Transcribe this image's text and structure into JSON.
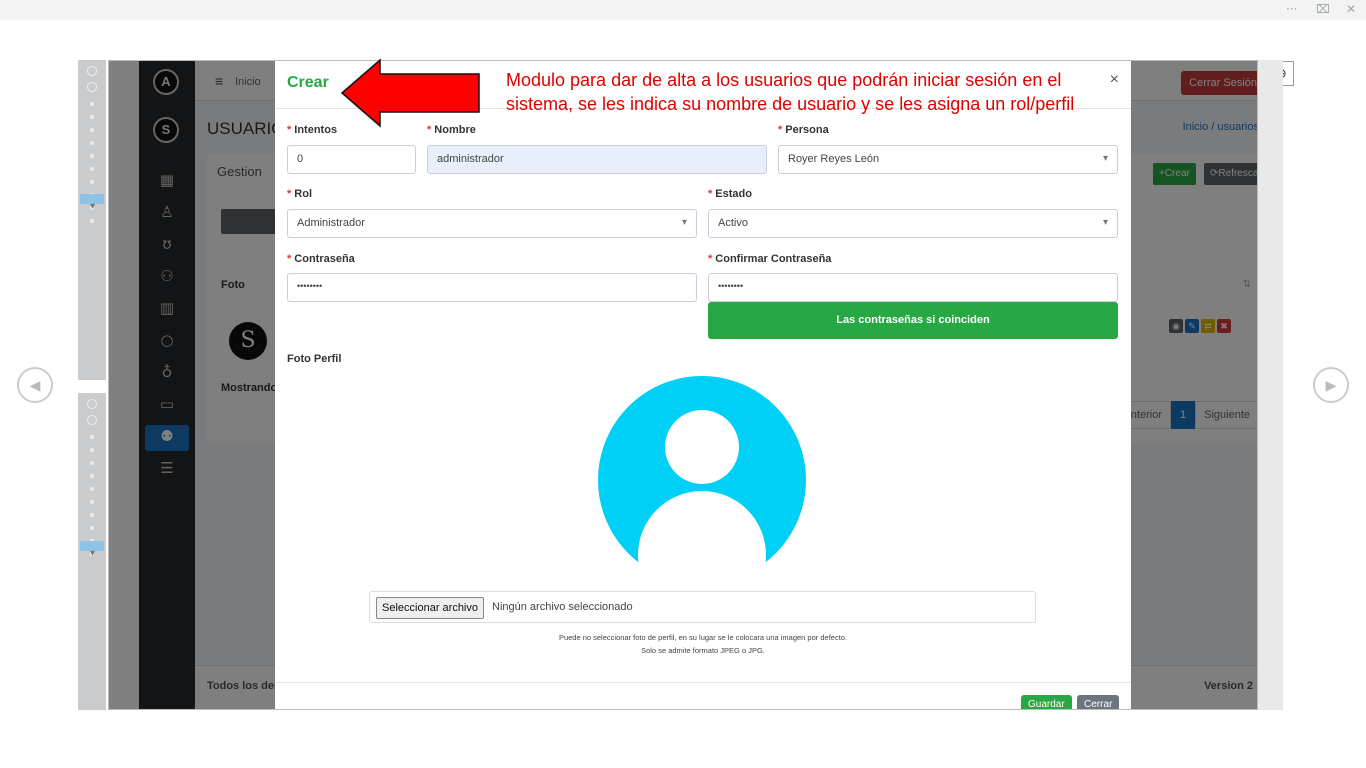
{
  "viewer": {
    "more": "···",
    "fit": "⌧",
    "close": "✕",
    "zoom": "⊖",
    "prev": "◀",
    "next": "▶"
  },
  "app": {
    "menu_label": "Inicio",
    "logout_label": "Cerrar Sesión",
    "page_title": "USUARIOS",
    "breadcrumb": "Inicio / usuarios",
    "tab_label": "Gestion",
    "create_label": "+Crear",
    "refresh_label": "⟳Refrescar",
    "col_foto": "Foto",
    "col_sort": "⇅",
    "showing": "Mostrando",
    "pager": {
      "prev": "Anterior",
      "page": "1",
      "next": "Siguiente"
    },
    "footer_left": "Todos los derechos reservados",
    "footer_right": "Version 2"
  },
  "modal": {
    "title": "Crear",
    "close": "×",
    "required_mark": "*",
    "fields": {
      "intentos": {
        "label": "Intentos",
        "value": "0"
      },
      "nombre": {
        "label": "Nombre",
        "value": "administrador"
      },
      "persona": {
        "label": "Persona",
        "value": "Royer Reyes León"
      },
      "rol": {
        "label": "Rol",
        "value": "Administrador"
      },
      "estado": {
        "label": "Estado",
        "value": "Activo"
      },
      "contrasena": {
        "label": "Contraseña",
        "value": "••••••••"
      },
      "confirmar": {
        "label": "Confirmar Contraseña",
        "value": "••••••••"
      }
    },
    "match_message": "Las contraseñas si coinciden",
    "foto_label": "Foto Perfil",
    "file_button": "Seleccionar archivo",
    "file_status": "Ningún archivo seleccionado",
    "hint1": "Puede no seleccionar foto de perfil, en su lugar se le colocara una imagen por defecto.",
    "hint2": "Solo se admite formato JPEG o JPG.",
    "save": "Guardar",
    "cancel": "Cerrar"
  },
  "annotation": "Modulo para dar de alta a los usuarios que podrán iniciar sesión en el sistema, se les indica su nombre de usuario y se les asigna un rol/perfil",
  "colors": {
    "accent_green": "#28a745",
    "annotation_red": "#e00000",
    "avatar_cyan": "#00d0f5",
    "sidebar_active": "#1a75c7"
  }
}
